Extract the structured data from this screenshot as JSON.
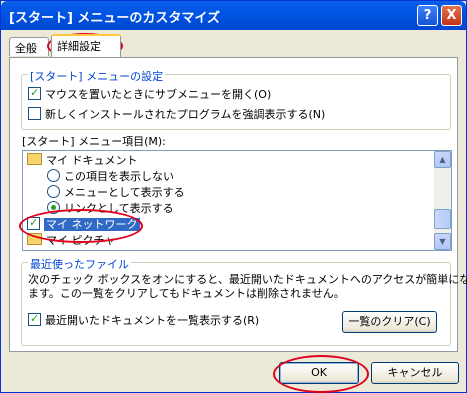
{
  "window": {
    "title": "[スタート] メニューのカスタマイズ",
    "help_label": "?",
    "close_label": "X"
  },
  "tabs": [
    {
      "label": "全般"
    },
    {
      "label": "詳細設定"
    }
  ],
  "start_menu_settings": {
    "legend": "[スタート] メニューの設定",
    "options": [
      {
        "label": "マウスを置いたときにサブメニューを開く(O)",
        "checked": true
      },
      {
        "label": "新しくインストールされたプログラムを強調表示する(N)",
        "checked": false
      }
    ]
  },
  "menu_items": {
    "label": "[スタート] メニュー項目(M):",
    "items": [
      {
        "label": "マイ ドキュメント",
        "type": "folder"
      },
      {
        "label": "この項目を表示しない",
        "type": "radio",
        "checked": false
      },
      {
        "label": "メニューとして表示する",
        "type": "radio",
        "checked": false
      },
      {
        "label": "リンクとして表示する",
        "type": "radio",
        "checked": true
      },
      {
        "label": "マイ ネットワーク",
        "type": "checkbox",
        "checked": true,
        "selected": true
      },
      {
        "label": "マイ ピクチャ",
        "type": "folder"
      }
    ],
    "scroll_up": "▲",
    "scroll_down": "▼"
  },
  "recent_docs": {
    "legend": "最近使ったファイル",
    "description_line1": "次のチェック ボックスをオンにすると、最近開いたドキュメントへのアクセスが簡単になり",
    "description_line2": "ます。この一覧をクリアしてもドキュメントは削除されません。",
    "checkbox_label": "最近開いたドキュメントを一覧表示する(R)",
    "checkbox_checked": true,
    "clear_button": "一覧のクリア(C)"
  },
  "footer": {
    "ok_label": "OK",
    "cancel_label": "キャンセル"
  },
  "colors": {
    "title_bar": "#0054e3",
    "annotation_ellipse": "#e0001c",
    "selection": "#316ac5",
    "group_legend": "#0046d5"
  }
}
